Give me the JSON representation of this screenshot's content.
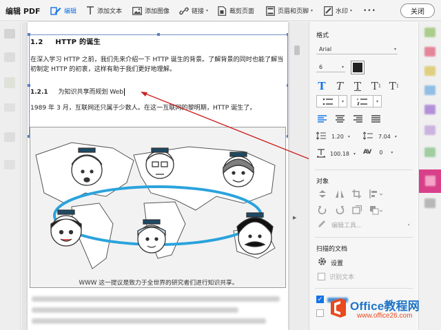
{
  "toolbar": {
    "title": "编辑 PDF",
    "edit_label": "编辑",
    "add_text_label": "添加文本",
    "add_image_label": "添加图像",
    "link_label": "链接",
    "crop_label": "裁剪页面",
    "header_footer_label": "页眉和页脚",
    "watermark_label": "水印",
    "more_label": "•••",
    "close_label": "关闭"
  },
  "page": {
    "section_number": "1.2",
    "section_title": "HTTP 的诞生",
    "para1": "在深入学习 HTTP 之前，我们先来介绍一下 HTTP 诞生的背景。了解背景的同时也能了解当初制定 HTTP 的初衷，这样有助于我们更好地理解。",
    "subsection_number": "1.2.1",
    "subsection_title": "为知识共享而规划 Web",
    "para2": "1989 年 3 月，互联网还只属于少数人。在这一互联网的黎明期，HTTP 诞生了。",
    "image_caption": "WWW 这一提议是致力于全世界的研究者们进行知识共享。"
  },
  "panel": {
    "format_heading": "格式",
    "font_name": "Arial",
    "font_size": "6",
    "text_color": "#222222",
    "line_spacing": "1.20",
    "para_spacing": "7.04",
    "horizontal_scale": "100.18",
    "char_spacing": "0",
    "char_spacing_icon": "AV",
    "objects_heading": "对象",
    "edit_tool_label": "编辑工具...",
    "scanned_heading": "扫描的文档",
    "settings_label": "设置",
    "recognize_text_label": "识别文本",
    "checkbox1_checked": true,
    "checkbox2_checked": false
  },
  "watermark": {
    "brand": "Office教程网",
    "url": "www.office26.com"
  },
  "colors": {
    "accent": "#1473e6",
    "frame": "#6f8fbf",
    "arrow": "#cc2222",
    "brand_orange": "#e8491d",
    "brand_blue": "#1e74c9"
  }
}
